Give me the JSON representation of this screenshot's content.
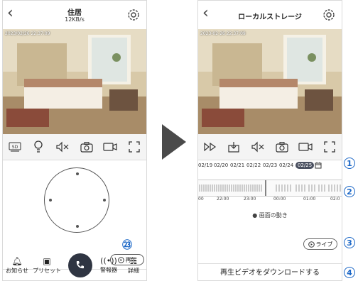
{
  "left": {
    "title": "住居",
    "speed": "12KB/s",
    "timestamp": "2023/02/26  22:37:09",
    "callout_23": "㉓",
    "play_label": "再生",
    "nav": [
      {
        "label": "お知らせ",
        "icon": "bell-icon"
      },
      {
        "label": "プリセット",
        "icon": "map-icon"
      },
      {
        "label": "警報器",
        "icon": "alarm-icon"
      },
      {
        "label": "詳細",
        "icon": "grid-icon"
      }
    ]
  },
  "right": {
    "title": "ローカルストレージ",
    "timestamp": "2023-02-26  22:37:09",
    "dates": [
      "02/19",
      "02/20",
      "02/21",
      "02/22",
      "02/23",
      "02/24",
      "02/25"
    ],
    "time_labels": [
      "00",
      "22:00",
      "23:00",
      "00:00",
      "01:00",
      "02:0"
    ],
    "motion_label": "● 画面の動き",
    "live_label": "ライブ",
    "download_label": "再生ビデオをダウンロードする",
    "callouts": [
      "1",
      "2",
      "3",
      "4"
    ]
  },
  "colors": {
    "accent": "#1a66c6",
    "call": "#2f3542"
  }
}
